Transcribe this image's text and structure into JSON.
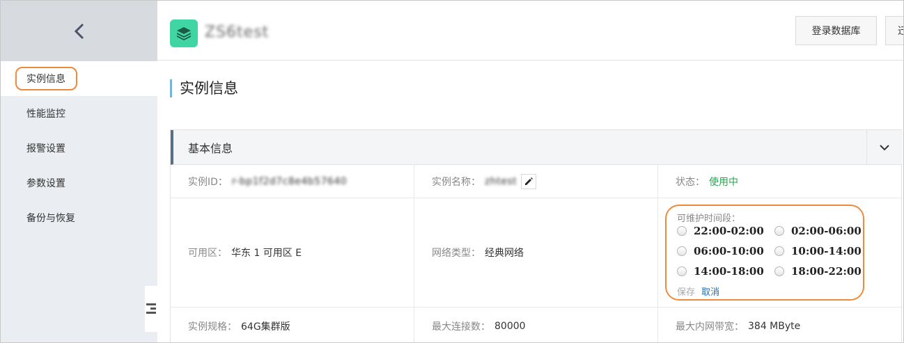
{
  "sidebar": {
    "items": [
      {
        "label": "实例信息"
      },
      {
        "label": "性能监控"
      },
      {
        "label": "报警设置"
      },
      {
        "label": "参数设置"
      },
      {
        "label": "备份与恢复"
      }
    ]
  },
  "header": {
    "instance_name": "ZS6test",
    "login_db_label": "登录数据库",
    "second_button_label": "迁"
  },
  "page_title": "实例信息",
  "basic_info": {
    "title": "基本信息",
    "instance_id_label": "实例ID：",
    "instance_id_value": "r-bp1f2d7c8e4b57640",
    "instance_name_label": "实例名称：",
    "instance_name_value": "zhtest",
    "status_label": "状态：",
    "status_value": "使用中",
    "zone_label": "可用区：",
    "zone_value": "华东 1 可用区 E",
    "network_label": "网络类型：",
    "network_value": "经典网络",
    "spec_label": "实例规格：",
    "spec_value": "64G集群版",
    "maxconn_label": "最大连接数：",
    "maxconn_value": "80000",
    "bandwidth_label": "最大内网带宽：",
    "bandwidth_value": "384 MByte"
  },
  "maintenance": {
    "label": "可维护时间段：",
    "options": [
      "22:00-02:00",
      "02:00-06:00",
      "06:00-10:00",
      "10:00-14:00",
      "14:00-18:00",
      "18:00-22:00"
    ],
    "save_label": "保存",
    "cancel_label": "取消"
  },
  "colors": {
    "accent_orange": "#ef8a3c",
    "status_green": "#2aa44f",
    "link_blue": "#1f6fb5",
    "logo_green": "#3fd6a4"
  }
}
